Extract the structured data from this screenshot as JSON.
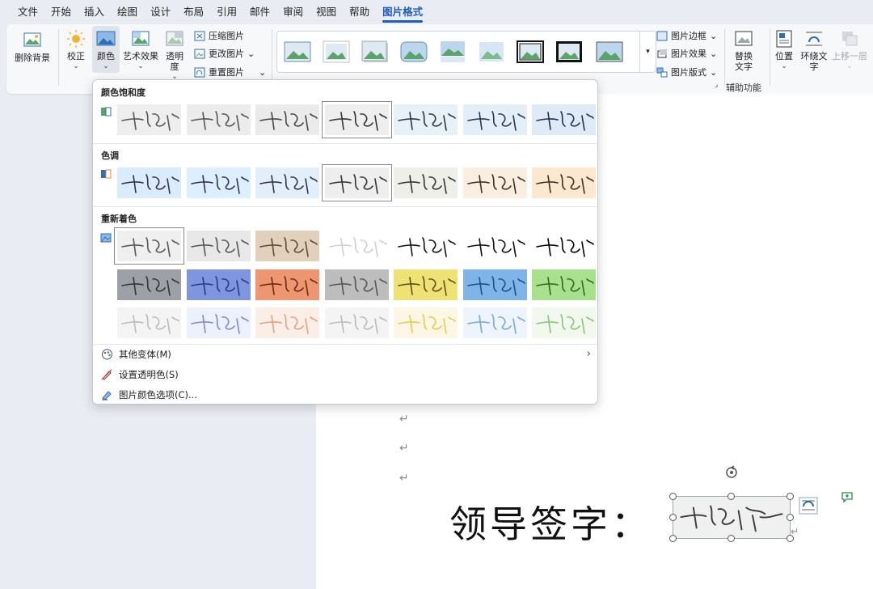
{
  "tabs": [
    "文件",
    "开始",
    "插入",
    "绘图",
    "设计",
    "布局",
    "引用",
    "邮件",
    "审阅",
    "视图",
    "帮助",
    "图片格式"
  ],
  "active_tab": "图片格式",
  "ribbon": {
    "remove_bg": "删除背景",
    "corrections": "校正",
    "color": "颜色",
    "artistic": "艺术效果",
    "transparency": "透明度",
    "compress": "压缩图片",
    "change": "更改图片",
    "reset": "重置图片",
    "border": "图片边框",
    "effects": "图片效果",
    "layout": "图片版式",
    "alt_text_1": "替换",
    "alt_text_2": "文字",
    "accessibility": "辅助功能",
    "position": "位置",
    "wrap_1": "环绕文",
    "wrap_2": "字",
    "bring_forward": "上移一层"
  },
  "dropdown": {
    "saturation_title": "颜色饱和度",
    "tone_title": "色调",
    "recolor_title": "重新着色",
    "more_variations": "其他变体(M)",
    "set_transparent": "设置透明色(S)",
    "color_options": "图片颜色选项(C)..."
  },
  "document": {
    "signature_label": "领导签字：",
    "return_mark": "↵"
  },
  "colors": {
    "accent": "#1e5bbf",
    "saturation_rows": [
      "#eeeeee",
      "#ececec",
      "#ebebeb",
      "#eeeeee",
      "#e6f1f8",
      "#e3eef9",
      "#dfeaf7"
    ],
    "tone_rows": [
      "#d8ecfb",
      "#dcefff",
      "#e3eefb",
      "#eeeeee",
      "#efefe9",
      "#faeee0",
      "#fbe8cf"
    ],
    "recolor_row1": [
      "#efefef",
      "#e8e8e8",
      "#e2d0bd",
      "#ffffff",
      "#ffffff",
      "#ffffff",
      "#ffffff"
    ],
    "recolor_row2": [
      "#9da0a6",
      "#7f95e0",
      "#ee9572",
      "#bdbdbd",
      "#efe275",
      "#7fb4e8",
      "#a8e08e"
    ],
    "recolor_row3": [
      "#f4f4f4",
      "#edf1fb",
      "#fbeee7",
      "#f4f4f4",
      "#fbf7e4",
      "#eef4fb",
      "#f1f8ee"
    ]
  }
}
